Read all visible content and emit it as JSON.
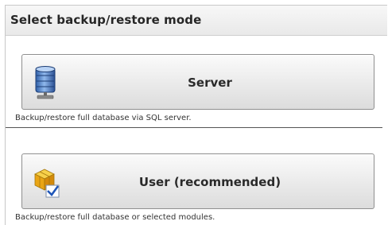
{
  "panel": {
    "title": "Select backup/restore mode"
  },
  "modes": [
    {
      "label": "Server",
      "icon": "database-server-icon",
      "description": "Backup/restore full database via SQL server."
    },
    {
      "label": "User (recommended)",
      "icon": "cubes-package-icon",
      "description": "Backup/restore full database or selected modules."
    }
  ]
}
